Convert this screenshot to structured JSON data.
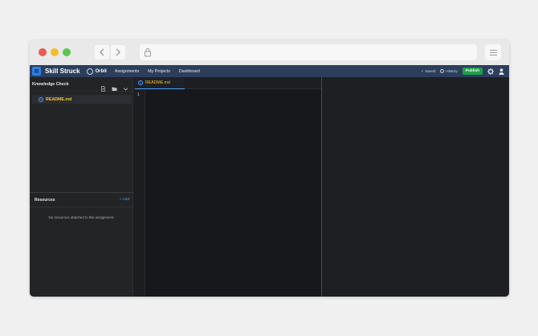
{
  "header": {
    "brand": "Skill Struck",
    "product": "Orbit",
    "nav": [
      "Assignments",
      "My Projects",
      "Dashboard"
    ],
    "status": "Saved",
    "history_label": "History",
    "publish_label": "Publish"
  },
  "sidebar": {
    "title": "Knowledge Check",
    "files": [
      {
        "name": "README.md"
      }
    ]
  },
  "resources": {
    "title": "Resources",
    "add_label": "+ Add",
    "empty_text": "No resources attached to this assignment."
  },
  "editor": {
    "tab": "README.md",
    "line_number": "1"
  },
  "colors": {
    "header_bg": "#2c3e5c",
    "publish": "#1e9e4a",
    "accent": "#4aa3ff",
    "file_highlight": "#f3c530"
  }
}
